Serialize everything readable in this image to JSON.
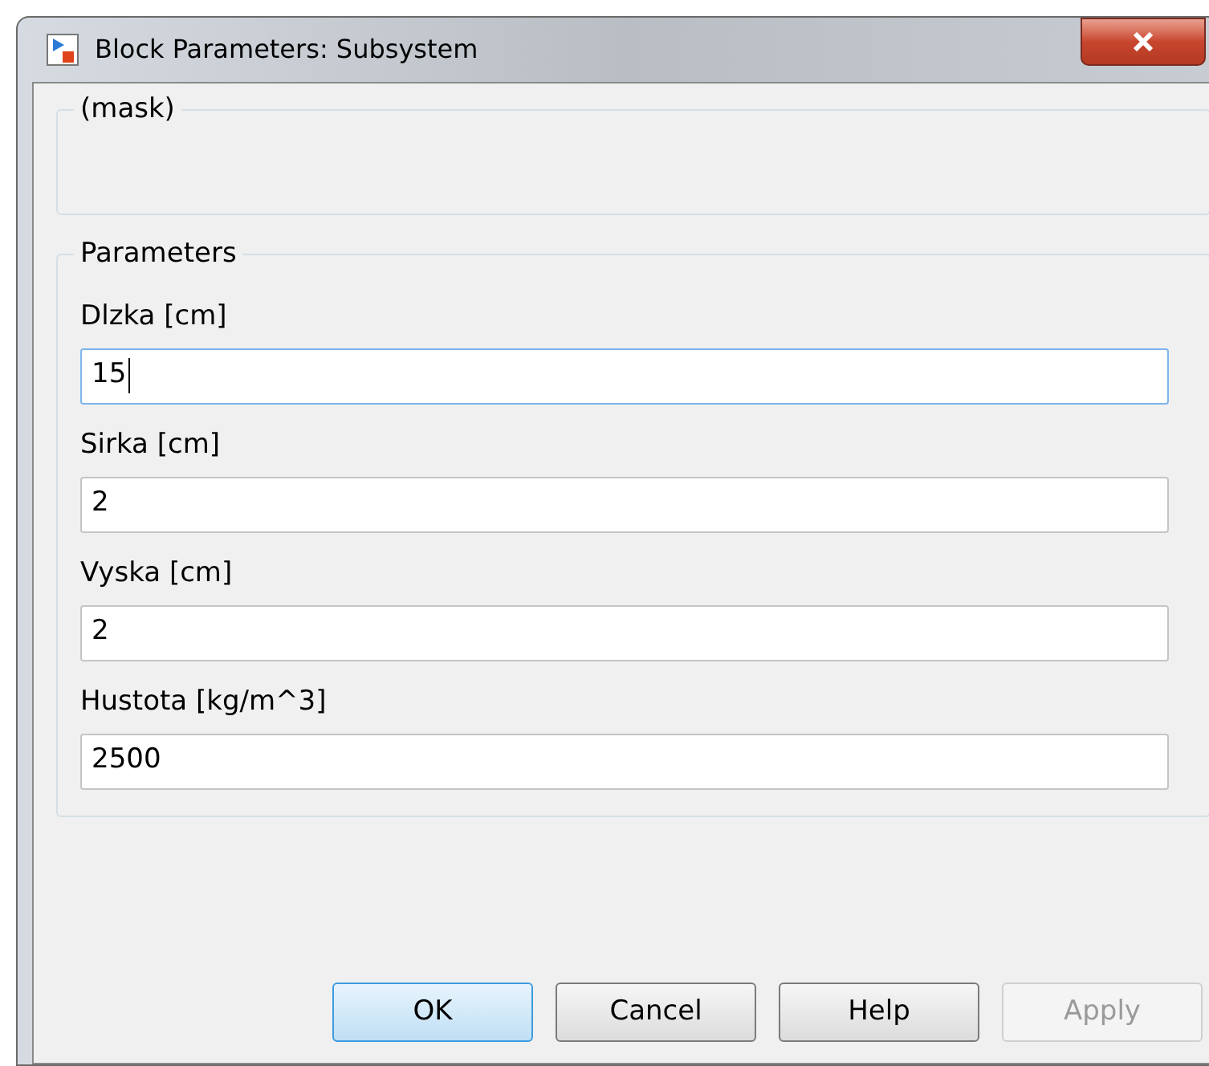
{
  "window": {
    "title": "Block Parameters: Subsystem"
  },
  "mask_group": {
    "title": "(mask)"
  },
  "parameters": {
    "title": "Parameters",
    "fields": [
      {
        "label": "Dlzka [cm]",
        "value": "15",
        "focused": true
      },
      {
        "label": "Sirka [cm]",
        "value": "2",
        "focused": false
      },
      {
        "label": "Vyska [cm]",
        "value": "2",
        "focused": false
      },
      {
        "label": "Hustota [kg/m^3]",
        "value": "2500",
        "focused": false
      }
    ]
  },
  "buttons": [
    {
      "label": "OK",
      "default": true,
      "disabled": false
    },
    {
      "label": "Cancel",
      "default": false,
      "disabled": false
    },
    {
      "label": "Help",
      "default": false,
      "disabled": false
    },
    {
      "label": "Apply",
      "default": false,
      "disabled": true
    }
  ]
}
